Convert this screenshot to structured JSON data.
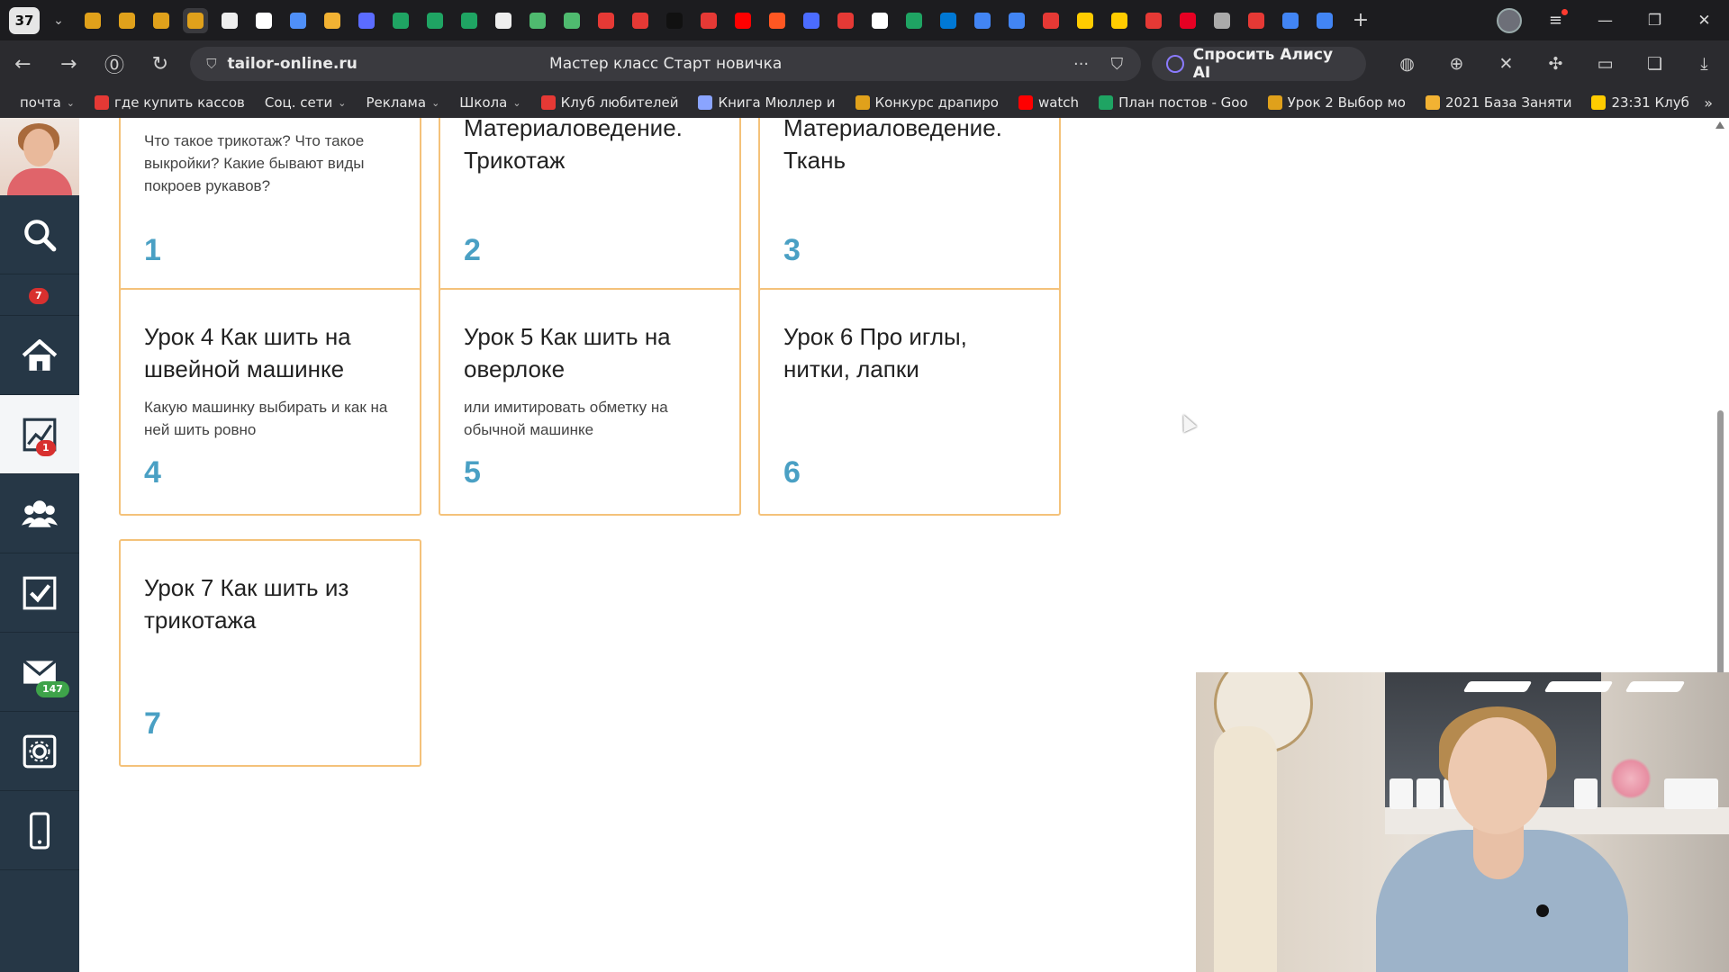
{
  "browser": {
    "tab_count": "37",
    "url_domain": "tailor-online.ru",
    "page_title": "Мастер класс Старт новичка",
    "alice_button": "Спросить Алису AI",
    "more_glyph": "···",
    "tab_icon_colors": [
      "#e0a11b",
      "#e0a11b",
      "#e0a11b",
      "#e0a11b",
      "#eeeeee",
      "#ffffff",
      "#4f8ff7",
      "#f2b233",
      "#5b6cff",
      "#1fa463",
      "#1fa463",
      "#1fa463",
      "#eeeeee",
      "#4fba6f",
      "#4fba6f",
      "#e53935",
      "#e53935",
      "#111111",
      "#e53935",
      "#ff0000",
      "#ff5722",
      "#4b6cff",
      "#e53935",
      "#ffffff",
      "#1fa463",
      "#0078d4",
      "#4285f4",
      "#4285f4",
      "#e53935",
      "#ffcc00",
      "#ffcc00",
      "#e53935",
      "#e60023",
      "#aaaaaa",
      "#e53935",
      "#4285f4",
      "#4285f4"
    ]
  },
  "bookmarks": [
    {
      "label": "почта",
      "caret": true,
      "color": ""
    },
    {
      "label": "где купить кассов",
      "caret": false,
      "color": "#e53935"
    },
    {
      "label": "Соц. сети",
      "caret": true,
      "color": ""
    },
    {
      "label": "Реклама",
      "caret": true,
      "color": ""
    },
    {
      "label": "Школа",
      "caret": true,
      "color": ""
    },
    {
      "label": "Клуб любителей",
      "caret": false,
      "color": "#e53935"
    },
    {
      "label": "Книга Мюллер и",
      "caret": false,
      "color": "#8aa4ff"
    },
    {
      "label": "Конкурс драпиро",
      "caret": false,
      "color": "#e0a11b"
    },
    {
      "label": "watch",
      "caret": false,
      "color": "#ff0000"
    },
    {
      "label": "План постов - Goo",
      "caret": false,
      "color": "#1fa463"
    },
    {
      "label": "Урок 2 Выбор мо",
      "caret": false,
      "color": "#e0a11b"
    },
    {
      "label": "2021 База Заняти",
      "caret": false,
      "color": "#f2b233"
    },
    {
      "label": "23:31 Клуб",
      "caret": false,
      "color": "#ffcc00"
    }
  ],
  "sidebar": {
    "notifications_badge": "7",
    "analytics_badge": "1",
    "mail_badge": "147"
  },
  "lessons": {
    "top_row": [
      {
        "title": "",
        "desc": "Что такое трикотаж? Что такое выкройки? Какие бывают виды покроев рукавов?",
        "number": "1"
      },
      {
        "title": "Материаловедение. Трикотаж",
        "desc": "",
        "number": "2"
      },
      {
        "title": "Материаловедение. Ткань",
        "desc": "",
        "number": "3"
      }
    ],
    "middle_row": [
      {
        "title": "Урок 4 Как шить на швейной машинке",
        "desc": "Какую машинку выбирать и как на ней шить ровно",
        "number": "4"
      },
      {
        "title": "Урок 5 Как шить на оверлоке",
        "desc": "или имитировать обметку на обычной машинке",
        "number": "5"
      },
      {
        "title": "Урок 6 Про иглы, нитки, лапки",
        "desc": "",
        "number": "6"
      }
    ],
    "bottom_row": [
      {
        "title": "Урок 7 Как шить из трикотажа",
        "desc": "",
        "number": "7"
      }
    ]
  },
  "colors": {
    "card_border": "#f4c27a",
    "lesson_number": "#4aa0c4",
    "sidebar_bg": "#263746",
    "badge_red": "#d8302f",
    "badge_green": "#3ea34a"
  }
}
